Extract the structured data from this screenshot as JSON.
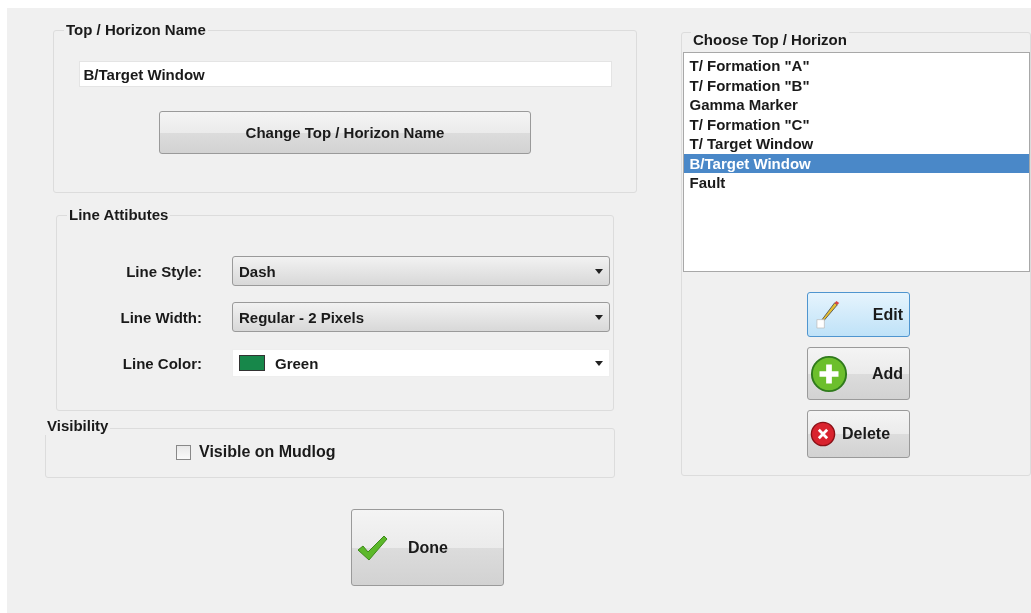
{
  "name_group": {
    "title": "Top / Horizon Name",
    "value": "B/Target Window",
    "button": "Change Top / Horizon Name"
  },
  "line_group": {
    "title": "Line Attibutes",
    "fields": [
      {
        "label": "Line Style:",
        "kind": "select",
        "value": "Dash"
      },
      {
        "label": "Line Width:",
        "kind": "select",
        "value": "Regular - 2 Pixels"
      },
      {
        "label": "Line Color:",
        "kind": "color",
        "value": "Green",
        "color": "#17874a"
      }
    ]
  },
  "visibility_group": {
    "title": "Visibility",
    "checkbox": {
      "label": "Visible on Mudlog",
      "checked": false
    }
  },
  "done_button": {
    "label": "Done"
  },
  "choose_group": {
    "title": "Choose Top / Horizon",
    "items": [
      {
        "label": "T/ Formation \"A\"",
        "selected": false
      },
      {
        "label": "T/ Formation \"B\"",
        "selected": false
      },
      {
        "label": "Gamma Marker",
        "selected": false
      },
      {
        "label": "T/ Formation \"C\"",
        "selected": false
      },
      {
        "label": "T/ Target Window",
        "selected": false
      },
      {
        "label": "B/Target Window",
        "selected": true
      },
      {
        "label": "Fault",
        "selected": false
      }
    ],
    "buttons": [
      {
        "label": "Edit",
        "kind": "edit",
        "hovered": true
      },
      {
        "label": "Add",
        "kind": "add",
        "hovered": false
      },
      {
        "label": "Delete",
        "kind": "delete",
        "hovered": false
      }
    ]
  }
}
